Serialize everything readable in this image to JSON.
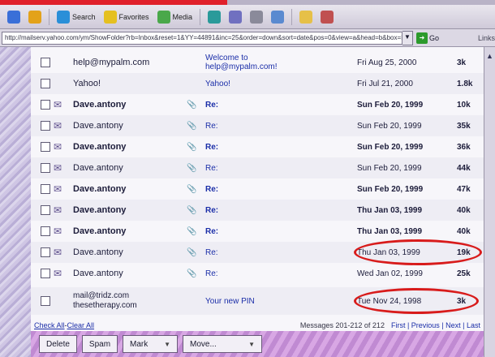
{
  "toolbar": {
    "items": [
      {
        "name": "back-icon",
        "label": ""
      },
      {
        "name": "home-icon",
        "label": ""
      },
      {
        "name": "search-icon",
        "label": "Search"
      },
      {
        "name": "favorites-icon",
        "label": "Favorites"
      },
      {
        "name": "media-icon",
        "label": "Media"
      },
      {
        "name": "history-icon",
        "label": ""
      },
      {
        "name": "mail-icon",
        "label": ""
      },
      {
        "name": "print-icon",
        "label": ""
      },
      {
        "name": "edit-icon",
        "label": ""
      },
      {
        "name": "folder-icon",
        "label": ""
      },
      {
        "name": "discuss-icon",
        "label": ""
      }
    ]
  },
  "address": {
    "url": "http://mailserv.yahoo.com/ym/ShowFolder?rb=Inbox&reset=1&YY=44891&inc=25&order=down&sort=date&pos=0&view=a&head=b&box=Inbox",
    "go_label": "Go",
    "links_label": "Links"
  },
  "messages": [
    {
      "sender": "help@mypalm.com",
      "bold": false,
      "subject": "Welcome to help@mypalm.com!",
      "subject_multiline": true,
      "attach": false,
      "date": "Fri Aug 25, 2000",
      "size": "3k",
      "date_bold": false
    },
    {
      "sender": "Yahoo!",
      "bold": false,
      "subject": "Yahoo!",
      "subject_multiline": false,
      "attach": false,
      "date": "Fri Jul 21, 2000",
      "size": "1.8k",
      "date_bold": false
    },
    {
      "sender": "Dave.antony",
      "bold": true,
      "subject": "Re:",
      "subject_multiline": false,
      "attach": true,
      "date": "Sun Feb 20, 1999",
      "size": "10k",
      "date_bold": true
    },
    {
      "sender": "Dave.antony",
      "bold": false,
      "subject": "Re:",
      "subject_multiline": false,
      "attach": true,
      "date": "Sun Feb 20, 1999",
      "size": "35k",
      "date_bold": false
    },
    {
      "sender": "Dave.antony",
      "bold": true,
      "subject": "Re:",
      "subject_multiline": false,
      "attach": true,
      "date": "Sun Feb 20, 1999",
      "size": "36k",
      "date_bold": true
    },
    {
      "sender": "Dave.antony",
      "bold": false,
      "subject": "Re:",
      "subject_multiline": false,
      "attach": true,
      "date": "Sun Feb 20, 1999",
      "size": "44k",
      "date_bold": false
    },
    {
      "sender": "Dave.antony",
      "bold": true,
      "subject": "Re:",
      "subject_multiline": false,
      "attach": true,
      "date": "Sun Feb 20, 1999",
      "size": "47k",
      "date_bold": true
    },
    {
      "sender": "Dave.antony",
      "bold": true,
      "subject": "Re:",
      "subject_multiline": false,
      "attach": true,
      "date": "Thu Jan 03, 1999",
      "size": "40k",
      "date_bold": true
    },
    {
      "sender": "Dave.antony",
      "bold": true,
      "subject": "Re:",
      "subject_multiline": false,
      "attach": true,
      "date": "Thu Jan 03, 1999",
      "size": "40k",
      "date_bold": true
    },
    {
      "sender": "Dave.antony",
      "bold": false,
      "subject": "Re:",
      "subject_multiline": false,
      "attach": true,
      "date": "Thu Jan 03, 1999",
      "size": "19k",
      "date_bold": false
    },
    {
      "sender": "Dave.antony",
      "bold": false,
      "subject": "Re:",
      "subject_multiline": false,
      "attach": true,
      "date": "Wed Jan 02, 1999",
      "size": "25k",
      "date_bold": false
    },
    {
      "sender": "mail@tridz.com",
      "bold": false,
      "subject": "Your new PIN",
      "subject_multiline": false,
      "attach": false,
      "date": "Tue Nov 24, 1998",
      "size": "3k",
      "date_bold": false,
      "sender_line2": "thesetherapy.com"
    }
  ],
  "footer": {
    "check_all": "Check All",
    "clear_all": "Clear All",
    "separator": " - ",
    "msgs_text": "Messages 201-212 of 212",
    "nav_text": "First | Previous | Next | Last"
  },
  "actions": {
    "delete": "Delete",
    "spam": "Spam",
    "mark": "Mark",
    "move": "Move..."
  },
  "colors": {
    "highlight_circle": "#d81b1b",
    "link": "#1b2ea8"
  }
}
